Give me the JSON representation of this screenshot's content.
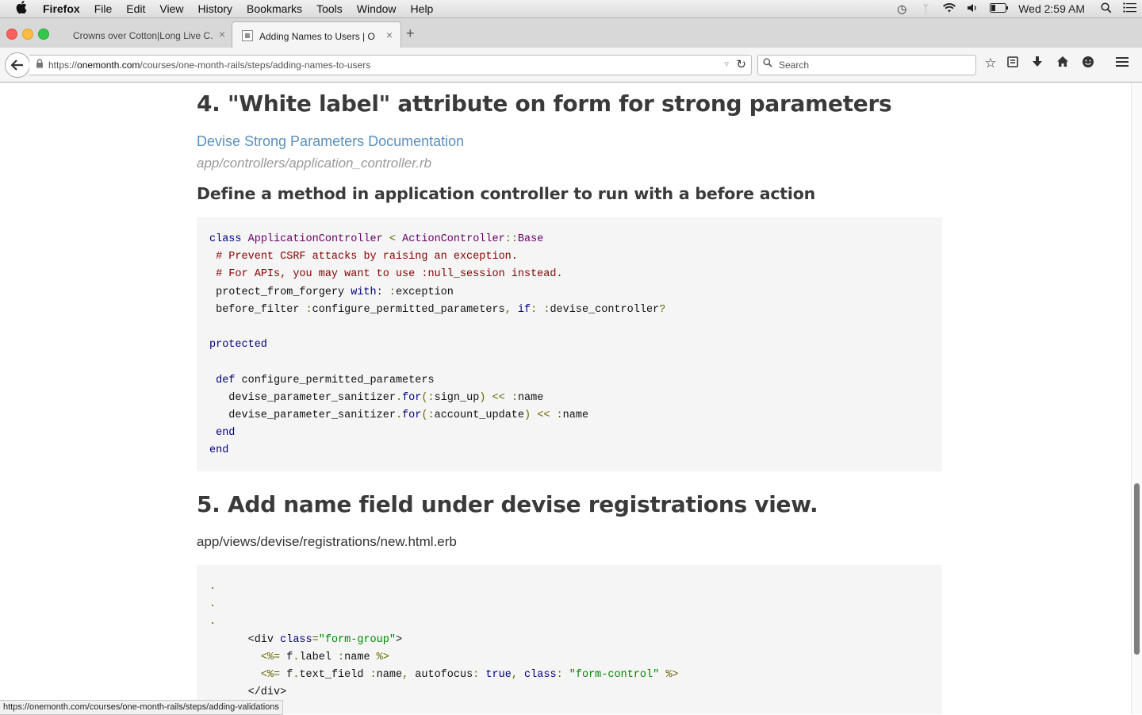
{
  "menubar": {
    "apple": "",
    "app": "Firefox",
    "items": [
      "File",
      "Edit",
      "View",
      "History",
      "Bookmarks",
      "Tools",
      "Window",
      "Help"
    ],
    "clock": "Wed 2:59 AM"
  },
  "tabs": [
    {
      "title": "Crowns over Cotton|Long Live C...",
      "close": "×"
    },
    {
      "title": "Adding Names to Users | O...",
      "close": "×"
    }
  ],
  "new_tab": "+",
  "urlbar": {
    "url_prefix": "https://",
    "url_domain": "onemonth.com",
    "url_path": "/courses/one-month-rails/steps/adding-names-to-users"
  },
  "search": {
    "placeholder": "Search"
  },
  "content": {
    "section4_heading": "4. \"White label\" attribute on form for strong parameters",
    "devise_link": "Devise Strong Parameters Documentation",
    "controller_path": "app/controllers/application_controller.rb",
    "method_heading": "Define a method in application controller to run with a before action",
    "section5_heading": "5. Add name field under devise registrations view.",
    "view_path": "app/views/devise/registrations/new.html.erb"
  },
  "code1": [
    [
      [
        "class",
        "kw"
      ],
      [
        " ",
        ""
      ],
      [
        "ApplicationController",
        "cn"
      ],
      [
        " ",
        ""
      ],
      [
        "<",
        "op"
      ],
      [
        " ",
        ""
      ],
      [
        "ActionController",
        "cn"
      ],
      [
        "::",
        "op"
      ],
      [
        "Base",
        "cn"
      ]
    ],
    [
      [
        " ",
        ""
      ],
      [
        "# Prevent CSRF attacks by raising an exception.",
        "cm"
      ]
    ],
    [
      [
        " ",
        ""
      ],
      [
        "# For APIs, you may want to use :null_session instead.",
        "cm"
      ]
    ],
    [
      [
        " protect_from_forgery ",
        ""
      ],
      [
        "with",
        "kw"
      ],
      [
        ":",
        ""
      ],
      [
        " ",
        ""
      ],
      [
        ":",
        "op"
      ],
      [
        "exception",
        ""
      ]
    ],
    [
      [
        " before_filter ",
        ""
      ],
      [
        ":",
        "op"
      ],
      [
        "configure_permitted_parameters",
        ""
      ],
      [
        ",",
        "op"
      ],
      [
        " ",
        ""
      ],
      [
        "if",
        "kw"
      ],
      [
        ":",
        "op"
      ],
      [
        " ",
        ""
      ],
      [
        ":",
        "op"
      ],
      [
        "devise_controller",
        ""
      ],
      [
        "?",
        "op"
      ]
    ],
    [],
    [
      [
        "protected",
        "kw"
      ]
    ],
    [],
    [
      [
        " ",
        ""
      ],
      [
        "def",
        "kw"
      ],
      [
        " configure_permitted_parameters",
        ""
      ]
    ],
    [
      [
        "   devise_parameter_sanitizer",
        ""
      ],
      [
        ".",
        "op"
      ],
      [
        "for",
        "kw"
      ],
      [
        "(",
        "op"
      ],
      [
        ":",
        "op"
      ],
      [
        "sign_up",
        ""
      ],
      [
        ")",
        "op"
      ],
      [
        " ",
        ""
      ],
      [
        "<<",
        "op"
      ],
      [
        " ",
        ""
      ],
      [
        ":",
        "op"
      ],
      [
        "name",
        ""
      ]
    ],
    [
      [
        "   devise_parameter_sanitizer",
        ""
      ],
      [
        ".",
        "op"
      ],
      [
        "for",
        "kw"
      ],
      [
        "(",
        "op"
      ],
      [
        ":",
        "op"
      ],
      [
        "account_update",
        ""
      ],
      [
        ")",
        "op"
      ],
      [
        " ",
        ""
      ],
      [
        "<<",
        "op"
      ],
      [
        " ",
        ""
      ],
      [
        ":",
        "op"
      ],
      [
        "name",
        ""
      ]
    ],
    [
      [
        " ",
        ""
      ],
      [
        "end",
        "kw"
      ]
    ],
    [
      [
        "end",
        "kw"
      ]
    ]
  ],
  "code2": [
    [
      [
        ".",
        "op"
      ]
    ],
    [
      [
        ".",
        "op"
      ]
    ],
    [
      [
        ".",
        "op"
      ]
    ],
    [
      [
        "      <div ",
        ""
      ],
      [
        "class",
        "kw"
      ],
      [
        "=",
        "op"
      ],
      [
        "\"form-group\"",
        "st"
      ],
      [
        ">",
        ""
      ]
    ],
    [
      [
        "        ",
        ""
      ],
      [
        "<%=",
        "op"
      ],
      [
        " f",
        ""
      ],
      [
        ".",
        "op"
      ],
      [
        "label ",
        ""
      ],
      [
        ":",
        "op"
      ],
      [
        "name ",
        ""
      ],
      [
        "%>",
        "op"
      ]
    ],
    [
      [
        "        ",
        ""
      ],
      [
        "<%=",
        "op"
      ],
      [
        " f",
        ""
      ],
      [
        ".",
        "op"
      ],
      [
        "text_field ",
        ""
      ],
      [
        ":",
        "op"
      ],
      [
        "name",
        ""
      ],
      [
        ",",
        "op"
      ],
      [
        " autofocus",
        ""
      ],
      [
        ":",
        "op"
      ],
      [
        " ",
        ""
      ],
      [
        "true",
        "kw"
      ],
      [
        ",",
        "op"
      ],
      [
        " ",
        ""
      ],
      [
        "class",
        "kw"
      ],
      [
        ":",
        "op"
      ],
      [
        " ",
        ""
      ],
      [
        "\"form-control\"",
        "st"
      ],
      [
        " ",
        ""
      ],
      [
        "%>",
        "op"
      ]
    ],
    [
      [
        "      </div>",
        ""
      ]
    ]
  ],
  "status_url": "https://onemonth.com/courses/one-month-rails/steps/adding-validations"
}
